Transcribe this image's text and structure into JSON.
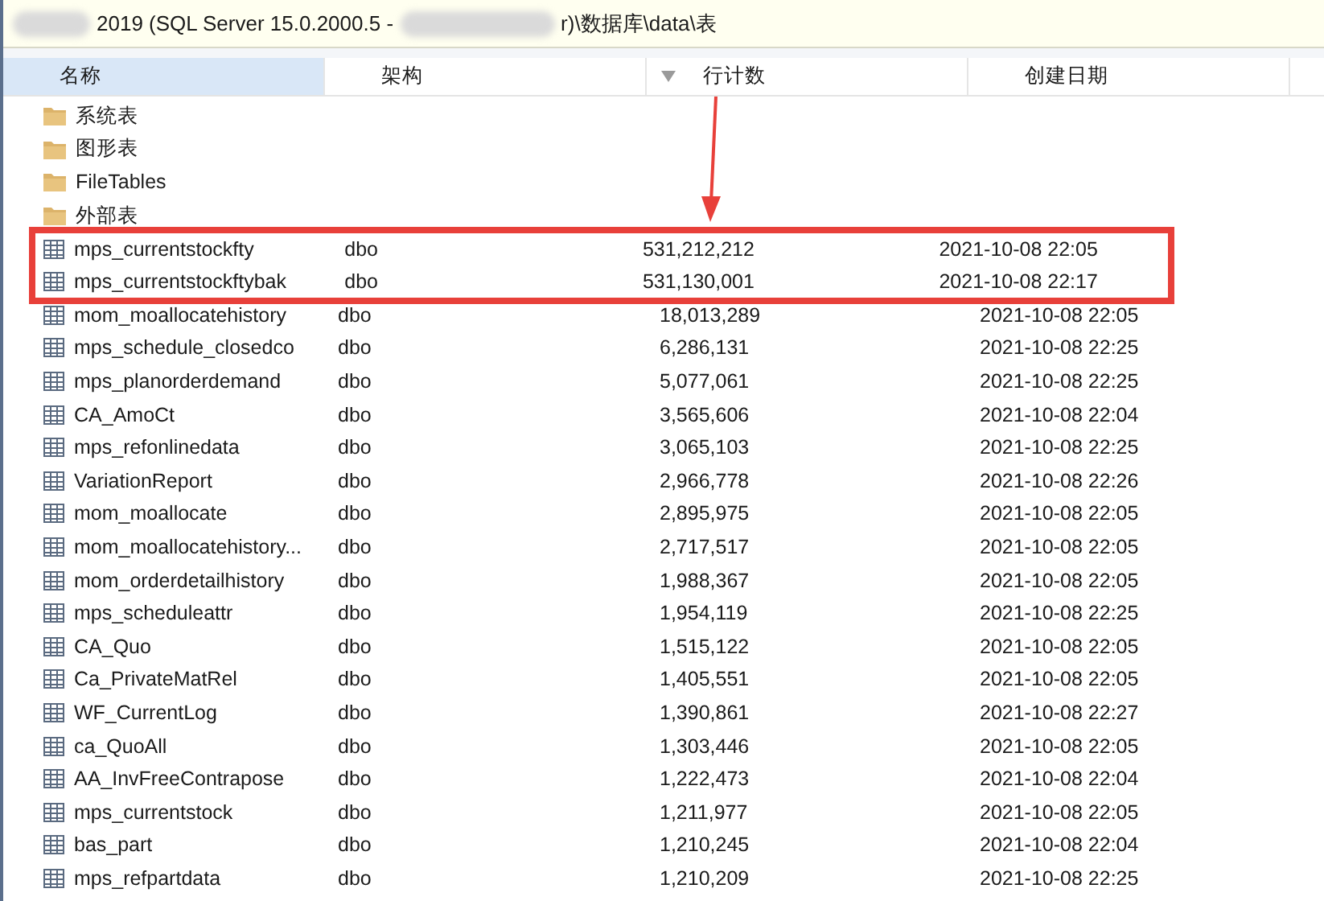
{
  "address_bar": {
    "path_start": "2019 (SQL Server 15.0.2000.5 -",
    "path_end": "r)\\数据库\\data\\表"
  },
  "columns": [
    {
      "label": "名称",
      "selected": true,
      "sorted": false
    },
    {
      "label": "架构",
      "selected": false,
      "sorted": false
    },
    {
      "label": "行计数",
      "selected": false,
      "sorted": true
    },
    {
      "label": "创建日期",
      "selected": false,
      "sorted": false
    }
  ],
  "folders": [
    {
      "name": "系统表"
    },
    {
      "name": "图形表"
    },
    {
      "name": "FileTables"
    },
    {
      "name": "外部表"
    }
  ],
  "rows": [
    {
      "name": "mps_currentstockfty",
      "schema": "dbo",
      "row_count": "531,212,212",
      "created": "2021-10-08 22:05",
      "highlighted": true
    },
    {
      "name": "mps_currentstockftybak",
      "schema": "dbo",
      "row_count": "531,130,001",
      "created": "2021-10-08 22:17",
      "highlighted": true
    },
    {
      "name": "mom_moallocatehistory",
      "schema": "dbo",
      "row_count": "18,013,289",
      "created": "2021-10-08 22:05",
      "highlighted": false
    },
    {
      "name": "mps_schedule_closedco",
      "schema": "dbo",
      "row_count": "6,286,131",
      "created": "2021-10-08 22:25",
      "highlighted": false
    },
    {
      "name": "mps_planorderdemand",
      "schema": "dbo",
      "row_count": "5,077,061",
      "created": "2021-10-08 22:25",
      "highlighted": false
    },
    {
      "name": "CA_AmoCt",
      "schema": "dbo",
      "row_count": "3,565,606",
      "created": "2021-10-08 22:04",
      "highlighted": false
    },
    {
      "name": "mps_refonlinedata",
      "schema": "dbo",
      "row_count": "3,065,103",
      "created": "2021-10-08 22:25",
      "highlighted": false
    },
    {
      "name": "VariationReport",
      "schema": "dbo",
      "row_count": "2,966,778",
      "created": "2021-10-08 22:26",
      "highlighted": false
    },
    {
      "name": "mom_moallocate",
      "schema": "dbo",
      "row_count": "2,895,975",
      "created": "2021-10-08 22:05",
      "highlighted": false
    },
    {
      "name": "mom_moallocatehistory...",
      "schema": "dbo",
      "row_count": "2,717,517",
      "created": "2021-10-08 22:05",
      "highlighted": false
    },
    {
      "name": "mom_orderdetailhistory",
      "schema": "dbo",
      "row_count": "1,988,367",
      "created": "2021-10-08 22:05",
      "highlighted": false
    },
    {
      "name": "mps_scheduleattr",
      "schema": "dbo",
      "row_count": "1,954,119",
      "created": "2021-10-08 22:25",
      "highlighted": false
    },
    {
      "name": "CA_Quo",
      "schema": "dbo",
      "row_count": "1,515,122",
      "created": "2021-10-08 22:05",
      "highlighted": false
    },
    {
      "name": "Ca_PrivateMatRel",
      "schema": "dbo",
      "row_count": "1,405,551",
      "created": "2021-10-08 22:05",
      "highlighted": false
    },
    {
      "name": "WF_CurrentLog",
      "schema": "dbo",
      "row_count": "1,390,861",
      "created": "2021-10-08 22:27",
      "highlighted": false
    },
    {
      "name": "ca_QuoAll",
      "schema": "dbo",
      "row_count": "1,303,446",
      "created": "2021-10-08 22:05",
      "highlighted": false
    },
    {
      "name": "AA_InvFreeContrapose",
      "schema": "dbo",
      "row_count": "1,222,473",
      "created": "2021-10-08 22:04",
      "highlighted": false
    },
    {
      "name": "mps_currentstock",
      "schema": "dbo",
      "row_count": "1,211,977",
      "created": "2021-10-08 22:05",
      "highlighted": false
    },
    {
      "name": "bas_part",
      "schema": "dbo",
      "row_count": "1,210,245",
      "created": "2021-10-08 22:04",
      "highlighted": false
    },
    {
      "name": "mps_refpartdata",
      "schema": "dbo",
      "row_count": "1,210,209",
      "created": "2021-10-08 22:25",
      "highlighted": false
    }
  ]
}
